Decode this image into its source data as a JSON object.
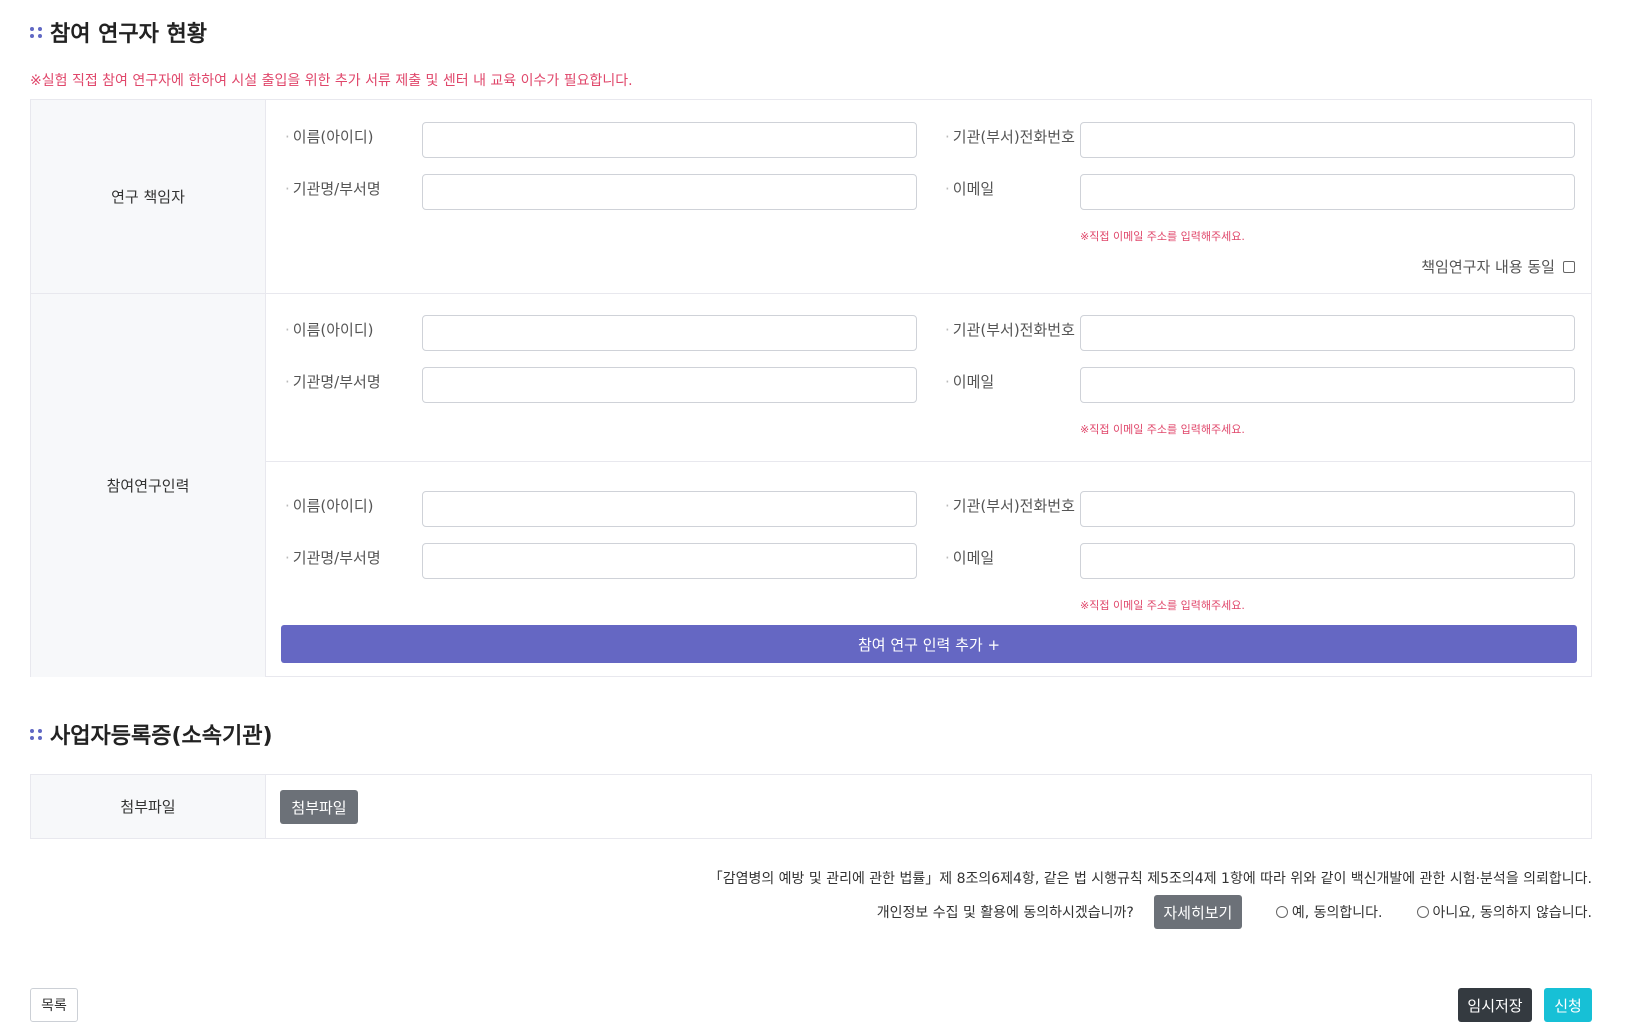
{
  "section1": {
    "title": "참여 연구자 현황"
  },
  "notice": "※실험 직접 참여 연구자에 한하여 시설 출입을 위한 추가 서류 제출 및 센터 내 교육 이수가 필요합니다.",
  "labels": {
    "name": "이름(아이디)",
    "phone": "기관(부서)전화번호",
    "org": "기관명/부서명",
    "email": "이메일",
    "email_hint": "※직접 이메일 주소를 입력해주세요."
  },
  "pi": {
    "label": "연구 책임자",
    "name_value": "",
    "phone_value": "",
    "org_value": "",
    "email_value": "",
    "same_as_pi_label": "책임연구자 내용 동일"
  },
  "participants": {
    "label": "참여연구인력",
    "add_button": "참여 연구 인력 추가 +"
  },
  "section2": {
    "title": "사업자등록증(소속기관)"
  },
  "attachment": {
    "label": "첨부파일",
    "button": "첨부파일"
  },
  "law_text": "「감염병의 예방 및 관리에 관한 법률」제 8조의6제4항, 같은 법 시행규칙 제5조의4제 1항에 따라 위와 같이 백신개발에 관한 시험·분석을 의뢰합니다.",
  "consent": {
    "question": "개인정보 수집 및 활용에 동의하시겠습니까?",
    "detail_button": "자세히보기",
    "yes": "예, 동의합니다.",
    "no": "아니요, 동의하지 않습니다."
  },
  "actions": {
    "list": "목록",
    "temp_save": "임시저장",
    "apply": "신청"
  }
}
